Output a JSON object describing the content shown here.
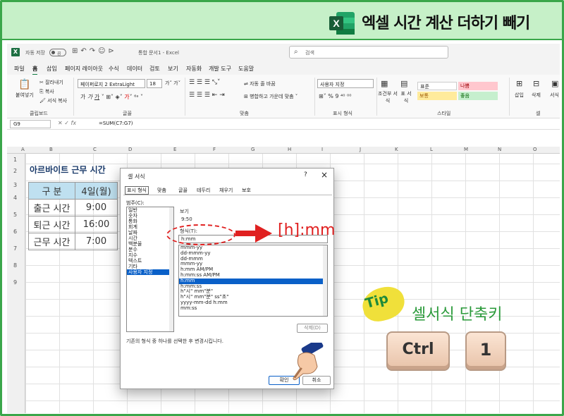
{
  "banner": {
    "title": "엑셀 시간 계산 더하기 빼기",
    "logo_letter": "X"
  },
  "titlebar": {
    "autosave": "자동 저장",
    "toggle": "끔",
    "doc_name": "통합 문서1 - Excel",
    "search_placeholder": "검색"
  },
  "menu": [
    "파일",
    "홈",
    "삽입",
    "페이지 레이아웃",
    "수식",
    "데이터",
    "검토",
    "보기",
    "자동화",
    "개발 도구",
    "도움말"
  ],
  "ribbon": {
    "paste": "붙여넣기",
    "cut": "잘라내기",
    "copy": "복사",
    "format_painter": "서식 복사",
    "clipboard": "클립보드",
    "font_name": "페이퍼로지 2 ExtraLight",
    "font_size": "18",
    "font_group": "글꼴",
    "wrap": "자동 줄 바꿈",
    "merge": "병합하고 가운데 맞춤",
    "align_group": "맞춤",
    "number_format": "사용자 지정",
    "number_group": "표시 형식",
    "cond_format": "조건부 서식",
    "table_format": "표 서식",
    "styles": {
      "normal": "표준",
      "bad": "나쁨",
      "neutral": "보통",
      "good": "좋음"
    },
    "style_group": "스타일",
    "insert": "삽입",
    "delete": "삭제",
    "format": "서식",
    "cells_group": "셀"
  },
  "formula": {
    "cell": "G9",
    "fx": "fx",
    "text": "=SUM(C7:G7)"
  },
  "columns": [
    "A",
    "B",
    "C",
    "D",
    "E",
    "F",
    "G",
    "H",
    "I",
    "J",
    "K",
    "L",
    "M",
    "N",
    "O"
  ],
  "rows": [
    "1",
    "2",
    "3",
    "4",
    "5",
    "6",
    "7",
    "8",
    "9"
  ],
  "sheet": {
    "title": "아르바이트 근무 시간",
    "table": [
      [
        "구 분",
        "4일(월)"
      ],
      [
        "출근 시간",
        "9:00"
      ],
      [
        "퇴근 시간",
        "16:00"
      ],
      [
        "근무 시간",
        "7:00"
      ]
    ]
  },
  "dialog": {
    "title": "셀 서식",
    "tabs": [
      "표시 형식",
      "맞춤",
      "글꼴",
      "테두리",
      "채우기",
      "보호"
    ],
    "category_label": "범주(C):",
    "categories": [
      "일반",
      "숫자",
      "통화",
      "회계",
      "날짜",
      "시간",
      "백분율",
      "분수",
      "지수",
      "텍스트",
      "기타",
      "사용자 지정"
    ],
    "selected_category": "사용자 지정",
    "sample_label": "보기",
    "sample_value": "9:50",
    "type_label": "형식(T):",
    "type_value": "h:mm",
    "formats": [
      "mmm-yy",
      "dd-mmm-yy",
      "dd-mmm",
      "mmm-yy",
      "h:mm AM/PM",
      "h:mm:ss AM/PM",
      "h:mm",
      "h:mm:ss",
      "h\"시\" mm\"분\"",
      "h\"시\" mm\"분\" ss\"초\"",
      "yyyy-mm-dd h:mm",
      "mm:ss"
    ],
    "selected_format": "h:mm",
    "delete_button": "삭제(D)",
    "description": "기존의 형식 중 하나를 선택한 후 변경시킵니다.",
    "ok": "확인",
    "cancel": "취소"
  },
  "annotation": {
    "format_text": "[h]:mm",
    "tip_badge": "Tip",
    "tip_label": "셀서식 단축키",
    "key1": "Ctrl",
    "key2": "1"
  }
}
